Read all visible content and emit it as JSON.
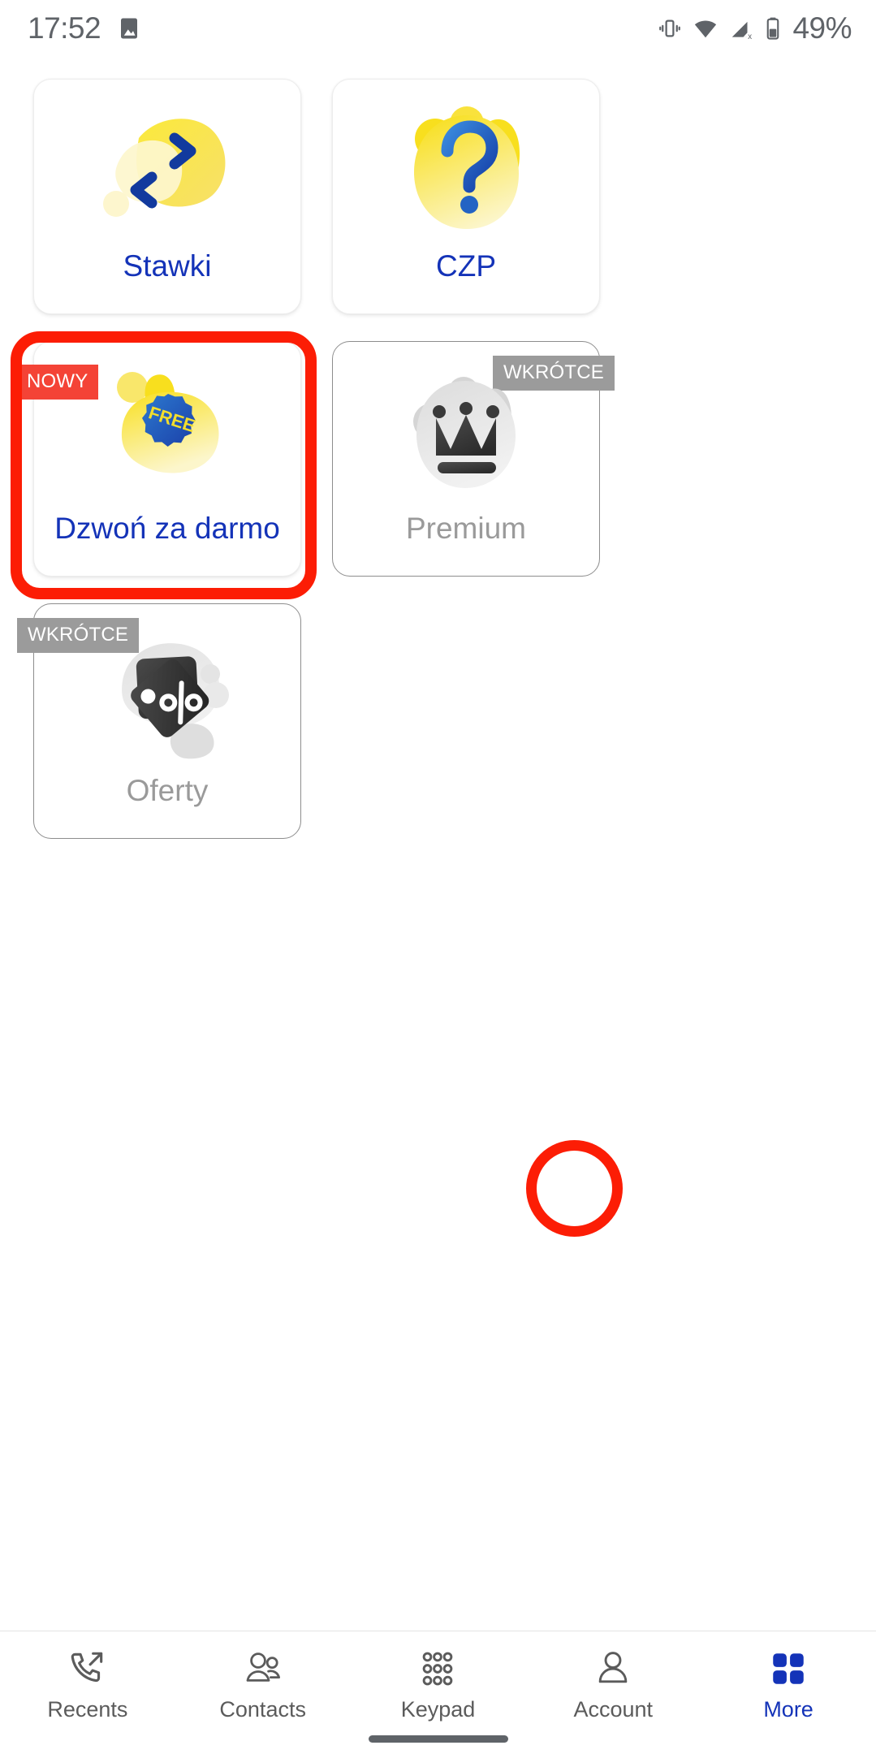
{
  "statusbar": {
    "time": "17:52",
    "battery_percent": "49%",
    "icons": [
      "image-icon",
      "vibrate-icon",
      "wifi-icon",
      "signal-off-icon",
      "battery-icon"
    ]
  },
  "colors": {
    "brand_blue": "#1433b8",
    "accent_yellow": "#F5DE29",
    "badge_new_red": "#f44336",
    "badge_soon_grey": "#9b9b9b",
    "highlight_red": "#fc1d05",
    "disabled_grey": "#9a9a9a"
  },
  "main": {
    "cards": [
      {
        "label": "Stawki",
        "icon": "exchange-arrows-icon",
        "state": "active",
        "badge": null,
        "highlighted": false
      },
      {
        "label": "CZP",
        "icon": "question-mark-icon",
        "state": "active",
        "badge": null,
        "highlighted": false
      },
      {
        "label": "Dzwoń za darmo",
        "icon": "free-badge-icon",
        "icon_text": "FREE",
        "state": "active",
        "badge": "NOWY",
        "badge_position": "left",
        "highlighted": true
      },
      {
        "label": "Premium",
        "icon": "crown-icon",
        "state": "disabled",
        "badge": "WKRÓTCE",
        "badge_position": "right",
        "highlighted": false
      },
      {
        "label": "Oferty",
        "icon": "discount-tag-icon",
        "state": "disabled",
        "badge": "WKRÓTCE",
        "badge_position": "left",
        "highlighted": false
      }
    ]
  },
  "bottomnav": {
    "items": [
      {
        "label": "Recents",
        "icon": "phone-outgoing-icon",
        "selected": false
      },
      {
        "label": "Contacts",
        "icon": "people-icon",
        "selected": false
      },
      {
        "label": "Keypad",
        "icon": "dialpad-icon",
        "selected": false
      },
      {
        "label": "Account",
        "icon": "person-icon",
        "selected": false
      },
      {
        "label": "More",
        "icon": "grid-squares-icon",
        "selected": true
      }
    ]
  }
}
